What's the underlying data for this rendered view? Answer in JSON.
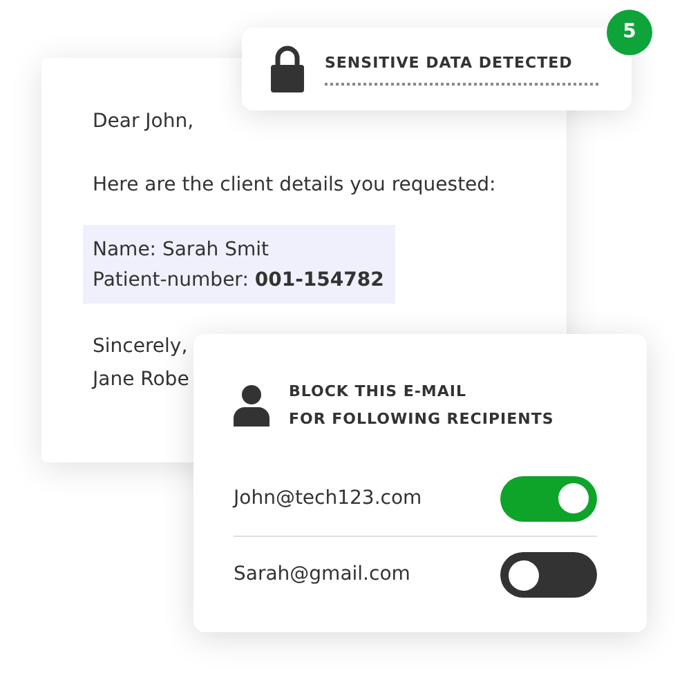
{
  "alert": {
    "title": "SENSITIVE DATA DETECTED",
    "count": "5"
  },
  "letter": {
    "greeting": "Dear John,",
    "intro": "Here are the client details you requested:",
    "highlight": [
      "Name: Sarah Smit",
      "Patient-number: **001-154782**"
    ],
    "closing": [
      "Sincerely,",
      "Jane Robe"
    ]
  },
  "block_panel": {
    "title": [
      "BLOCK THIS E-MAIL",
      "FOR FOLLOWING RECIPIENTS"
    ],
    "recipients": [
      {
        "email": "John@tech123.com",
        "on": true
      },
      {
        "email": "Sarah@gmail.com",
        "on": false
      }
    ]
  }
}
